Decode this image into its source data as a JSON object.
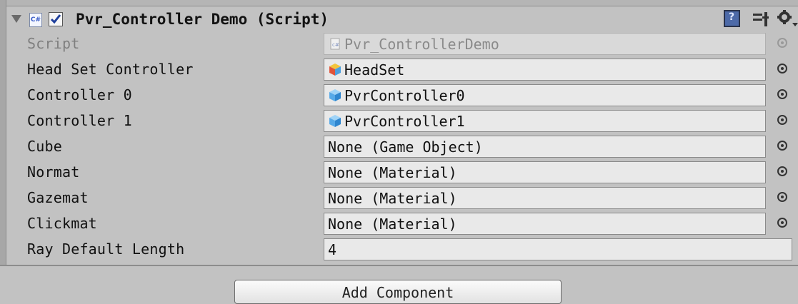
{
  "component": {
    "title": "Pvr_Controller Demo (Script)",
    "enabled": true,
    "icons": {
      "foldout": "foldout-arrow-icon",
      "script": "csharp-script-icon",
      "help": "help-book-icon",
      "presets": "presets-icon",
      "settings": "gear-icon"
    }
  },
  "fields": [
    {
      "label": "Script",
      "value": "Pvr_ControllerDemo",
      "disabled": true,
      "icon": "csharp-script-icon"
    },
    {
      "label": "Head Set Controller",
      "value": "HeadSet",
      "icon": "prefab-multicolor-cube-icon"
    },
    {
      "label": "Controller 0",
      "value": "PvrController0",
      "icon": "prefab-cube-icon"
    },
    {
      "label": "Controller 1",
      "value": "PvrController1",
      "icon": "prefab-cube-icon"
    },
    {
      "label": "Cube",
      "value": "None (Game Object)"
    },
    {
      "label": "Normat",
      "value": "None (Material)"
    },
    {
      "label": "Gazemat",
      "value": "None (Material)"
    },
    {
      "label": "Clickmat",
      "value": "None (Material)"
    },
    {
      "label": "Ray Default Length",
      "value": "4"
    }
  ],
  "footer": {
    "add_component_label": "Add Component"
  },
  "colors": {
    "panel": "#c2c2c2",
    "field": "#e9e9e9",
    "help_icon": "#4d6aa8",
    "prefab_blue": "#56a9e8"
  }
}
